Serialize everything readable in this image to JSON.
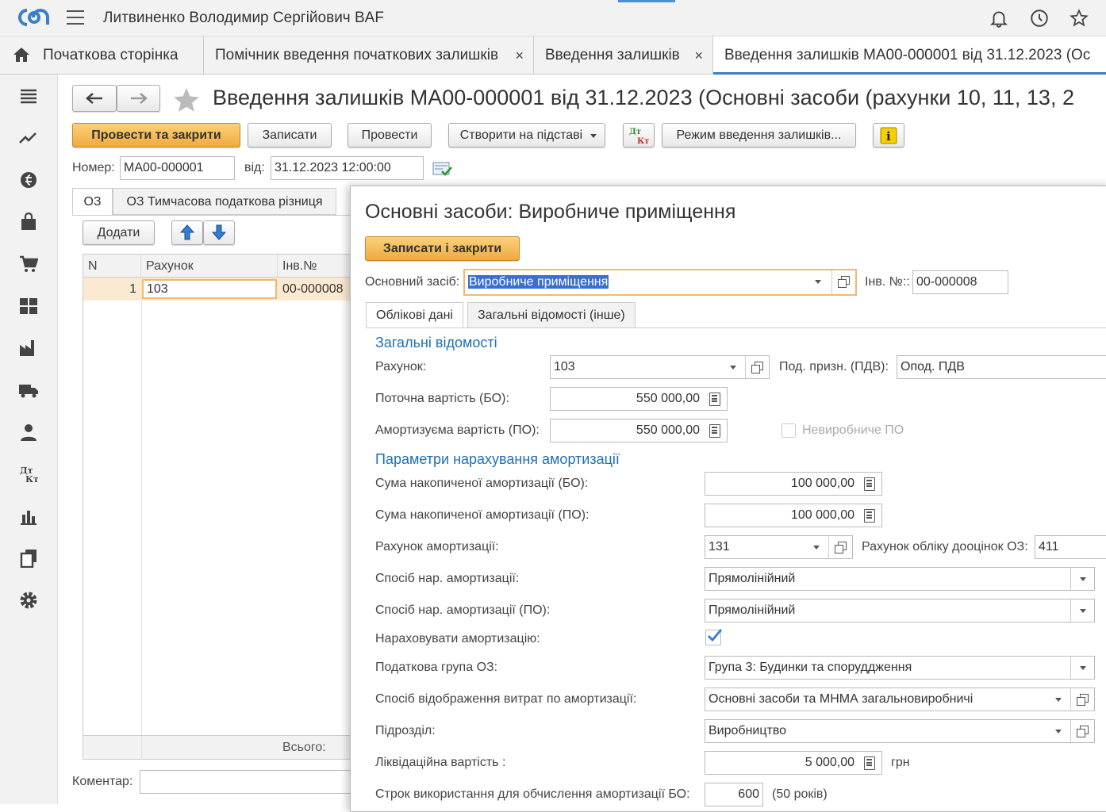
{
  "topbar": {
    "user": "Литвиненко Володимир Сергійович BAF",
    "icons": [
      "bell-icon",
      "history-icon",
      "star-icon"
    ]
  },
  "tabs": [
    {
      "label": "Початкова сторінка"
    },
    {
      "label": "Помічник введення початкових залишків",
      "close": "×"
    },
    {
      "label": "Введення залишків",
      "close": "×"
    },
    {
      "label": "Введення залишків МА00-000001 від 31.12.2023 (Ос"
    }
  ],
  "sidebar": [
    "menu-icon",
    "trend-icon",
    "money-icon",
    "bag-icon",
    "cart-icon",
    "warehouse-icon",
    "factory-icon",
    "truck-icon",
    "person-icon",
    "dtkt-icon",
    "chart-icon",
    "docs-icon",
    "gear-icon"
  ],
  "doc": {
    "title": "Введення залишків МА00-000001 від 31.12.2023 (Основні засоби (рахунки 10, 11, 13, 2",
    "buttons": {
      "post_close": "Провести та закрити",
      "save": "Записати",
      "post": "Провести",
      "create_based": "Створити на підставі",
      "mode": "Режим введення залишків..."
    },
    "number_label": "Номер:",
    "number": "МА00-000001",
    "date_label": "від:",
    "date": "31.12.2023 12:00:00",
    "tabs": [
      "ОЗ",
      "ОЗ Тимчасова податкова різниця"
    ],
    "add": "Додати",
    "grid": {
      "headers": [
        "N",
        "Рахунок",
        "Інв.№"
      ],
      "rows": [
        {
          "n": "1",
          "account": "103",
          "inv": "00-000008"
        }
      ],
      "total": "Всього:"
    },
    "comment_label": "Коментар:"
  },
  "dialog": {
    "title": "Основні засоби: Виробниче приміщення",
    "save_close": "Записати і закрити",
    "asset_label": "Основний засіб:",
    "asset": "Виробниче приміщення",
    "inv_label": "Інв. №::",
    "inv": "00-000008",
    "tabs": [
      "Облікові дані",
      "Загальні відомості (інше)"
    ],
    "general": "Загальні відомості",
    "account_label": "Рахунок:",
    "account": "103",
    "tax_label": "Под. призн. (ПДВ):",
    "tax": "Опод. ПДВ",
    "cur_value_label": "Поточна вартість (БО):",
    "cur_value": "550 000,00",
    "amort_value_label": "Амортизуєма вартість (ПО):",
    "amort_value": "550 000,00",
    "nonprod_label": "Невиробниче ПО",
    "params": "Параметри нарахування амортизації",
    "acc_bo_label": "Сума накопиченої амортизації (БО):",
    "acc_bo": "100 000,00",
    "acc_po_label": "Сума накопиченої амортизації (ПО):",
    "acc_po": "100 000,00",
    "amort_acc_label": "Рахунок амортизації:",
    "amort_acc": "131",
    "reval_label": "Рахунок обліку дооцінок ОЗ:",
    "reval": "411",
    "method_label": "Спосіб нар. амортизації:",
    "method": "Прямолінійний",
    "method_po_label": "Спосіб нар. амортизації (ПО):",
    "method_po": "Прямолінійний",
    "charge_label": "Нараховувати амортизацію:",
    "group_label": "Податкова група ОЗ:",
    "group": "Група 3: Будинки та споруддження",
    "expense_label": "Спосіб відображення витрат по амортизації:",
    "expense": "Основні засоби та МНМА загальновиробничі",
    "dept_label": "Підрозділ:",
    "dept": "Виробництво",
    "liq_label": "Ліквідаційна вартість :",
    "liq": "5 000,00",
    "liq_unit": "грн",
    "term_label": "Строк використання для обчислення амортизації БО:",
    "term": "600",
    "term_note": "(50 років)"
  }
}
